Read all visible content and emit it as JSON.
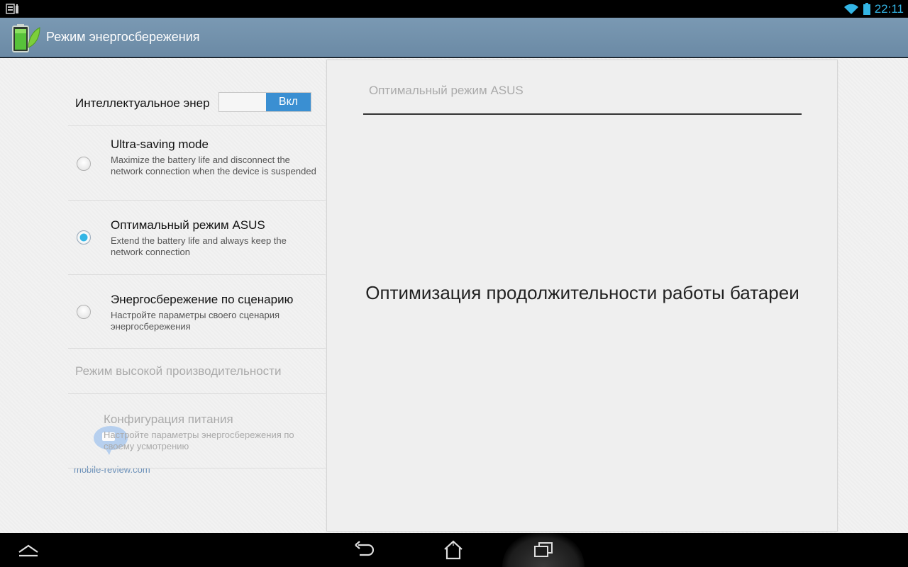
{
  "status_bar": {
    "time": "22:11",
    "left_icon": "notification-icon",
    "icons": [
      "wifi-icon",
      "battery-icon"
    ],
    "accent_color": "#33b5e5"
  },
  "action_bar": {
    "title": "Режим энергосбережения",
    "icon": "battery-leaf-icon",
    "color": "#6b8aa5"
  },
  "smart_saving": {
    "label": "Интеллектуальное энергосбережение",
    "switch_on_label": "Вкл",
    "enabled": true
  },
  "modes": [
    {
      "title": "Ultra-saving mode",
      "description": "Maximize the battery life and disconnect the network connection when the device is suspended",
      "selected": false
    },
    {
      "title": "Оптимальный режим ASUS",
      "description": "Extend the battery life and always keep the network connection",
      "selected": true
    },
    {
      "title": "Энергосбережение по сценарию",
      "description": "Настройте параметры своего сценария энергосбережения",
      "selected": false
    }
  ],
  "high_performance": {
    "title": "Режим высокой производительности"
  },
  "power_config": {
    "title": "Конфигурация питания",
    "description": "Настройте параметры энергосбережения по своему усмотрению"
  },
  "watermark": {
    "text": "mobile-review.com"
  },
  "detail": {
    "header": "Оптимальный режим ASUS",
    "message": "Оптимизация продолжительности работы батареи"
  },
  "nav_bar": {
    "buttons": [
      "collapse-icon",
      "back-icon",
      "home-icon",
      "recents-icon"
    ]
  }
}
